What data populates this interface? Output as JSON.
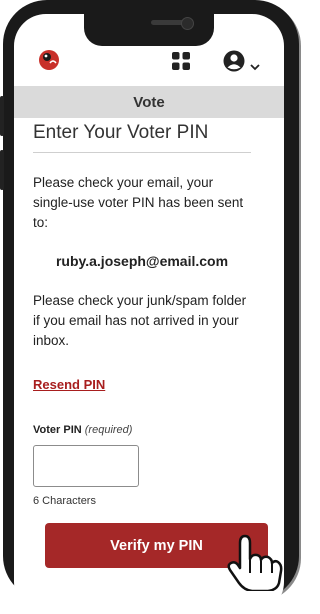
{
  "header": {
    "logo_icon": "ladybug-logo-icon",
    "apps_icon": "grid-apps-icon",
    "account_icon": "account-circle-icon",
    "caret_icon": "chevron-down-icon"
  },
  "title_bar": {
    "title": "Vote"
  },
  "main": {
    "heading": "Enter Your Voter PIN",
    "intro": "Please check your email, your single-use voter PIN has been sent to:",
    "email": "ruby.a.joseph@email.com",
    "spam_note": "Please check your junk/spam folder if you email has not arrived in your inbox.",
    "resend_label": "Resend PIN",
    "pin_label": "Voter PIN",
    "pin_required": "(required)",
    "pin_value": "",
    "pin_hint": "6 Characters",
    "verify_label": "Verify my PIN"
  },
  "colors": {
    "accent": "#a52828",
    "title_bar": "#dadada",
    "link": "#a81e1e"
  }
}
